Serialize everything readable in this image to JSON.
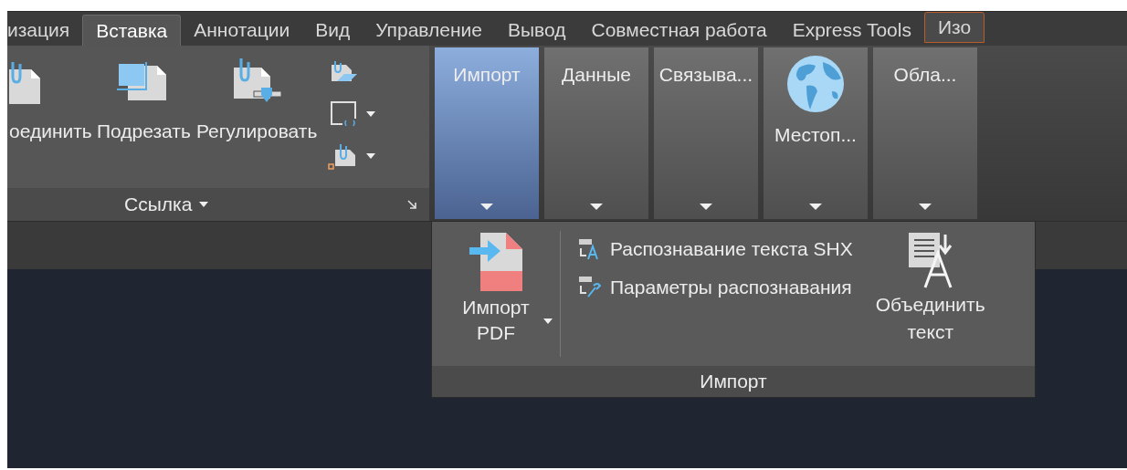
{
  "tabs": [
    {
      "label": "изация",
      "selected": false,
      "contextual": false
    },
    {
      "label": "Вставка",
      "selected": true,
      "contextual": false
    },
    {
      "label": "Аннотации",
      "selected": false,
      "contextual": false
    },
    {
      "label": "Вид",
      "selected": false,
      "contextual": false
    },
    {
      "label": "Управление",
      "selected": false,
      "contextual": false
    },
    {
      "label": "Вывод",
      "selected": false,
      "contextual": false
    },
    {
      "label": "Совместная работа",
      "selected": false,
      "contextual": false
    },
    {
      "label": "Express Tools",
      "selected": false,
      "contextual": false
    },
    {
      "label": "Изо",
      "selected": false,
      "contextual": true
    }
  ],
  "reference_panel": {
    "title": "Ссылка",
    "buttons": [
      {
        "label": "оединить",
        "kind": "attach"
      },
      {
        "label": "Подрезать",
        "kind": "clip"
      },
      {
        "label": "Регулировать",
        "kind": "adjust"
      }
    ],
    "small_buttons": [
      {
        "kind": "underlay",
        "dropdown": false
      },
      {
        "kind": "frame",
        "dropdown": true
      },
      {
        "kind": "attach",
        "dropdown": true
      }
    ]
  },
  "collapsed_panels": [
    {
      "label": "Импорт",
      "selected": true,
      "kind": "text"
    },
    {
      "label": "Данные",
      "selected": false,
      "kind": "text"
    },
    {
      "label": "Связыва...",
      "selected": false,
      "kind": "text"
    },
    {
      "label": "Местоп...",
      "selected": false,
      "kind": "globe"
    },
    {
      "label": "Обла...",
      "selected": false,
      "kind": "text"
    }
  ],
  "popup": {
    "title": "Импорт",
    "import_button": {
      "label": "Импорт PDF",
      "dropdown": true
    },
    "items": [
      {
        "label": "Распознавание текста SHX",
        "kind": "recognize"
      },
      {
        "label": "Параметры распознавания",
        "kind": "settings"
      }
    ],
    "combine_button": {
      "label": "Объединить текст"
    }
  }
}
